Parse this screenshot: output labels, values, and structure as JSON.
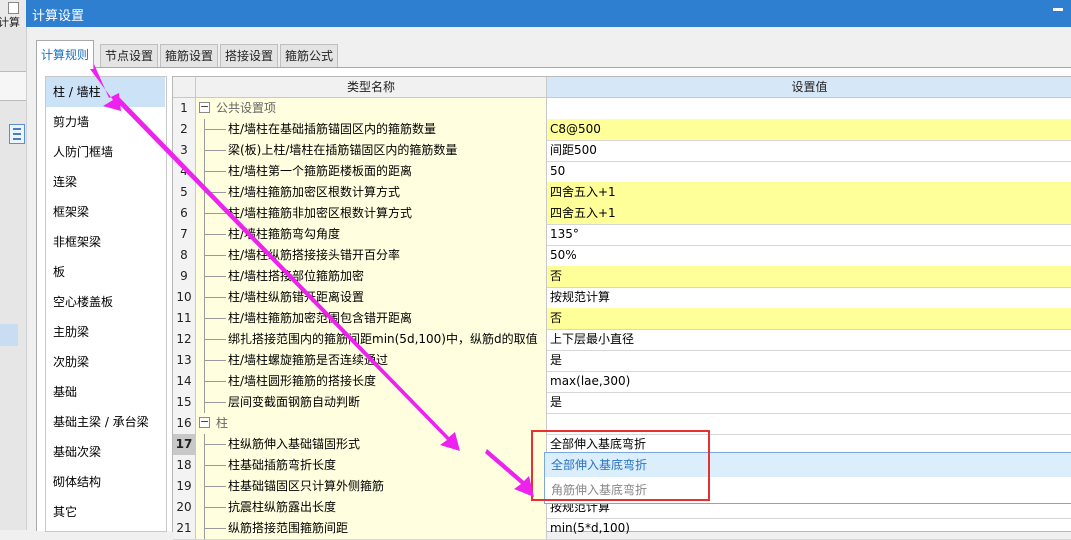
{
  "window": {
    "title": "计算设置",
    "app_title": "计算"
  },
  "tabs": [
    {
      "label": "计算规则",
      "active": true
    },
    {
      "label": "节点设置",
      "active": false
    },
    {
      "label": "箍筋设置",
      "active": false
    },
    {
      "label": "搭接设置",
      "active": false
    },
    {
      "label": "箍筋公式",
      "active": false
    }
  ],
  "categories": [
    "柱 / 墙柱",
    "剪力墙",
    "人防门框墙",
    "连梁",
    "框架梁",
    "非框架梁",
    "板",
    "空心楼盖板",
    "主肋梁",
    "次肋梁",
    "基础",
    "基础主梁 / 承台梁",
    "基础次梁",
    "砌体结构",
    "其它"
  ],
  "grid": {
    "col_name": "类型名称",
    "col_value": "设置值",
    "rows": [
      {
        "n": "1",
        "name": "公共设置项",
        "value": "",
        "group": true,
        "yellow": false
      },
      {
        "n": "2",
        "name": "柱/墙柱在基础插筋锚固区内的箍筋数量",
        "value": "C8@500",
        "group": false,
        "yellow": true
      },
      {
        "n": "3",
        "name": "梁(板)上柱/墙柱在插筋锚固区内的箍筋数量",
        "value": "间距500",
        "group": false,
        "yellow": false
      },
      {
        "n": "4",
        "name": "柱/墙柱第一个箍筋距楼板面的距离",
        "value": "50",
        "group": false,
        "yellow": false
      },
      {
        "n": "5",
        "name": "柱/墙柱箍筋加密区根数计算方式",
        "value": "四舍五入+1",
        "group": false,
        "yellow": true
      },
      {
        "n": "6",
        "name": "柱/墙柱箍筋非加密区根数计算方式",
        "value": "四舍五入+1",
        "group": false,
        "yellow": true
      },
      {
        "n": "7",
        "name": "柱/墙柱箍筋弯勾角度",
        "value": "135°",
        "group": false,
        "yellow": false
      },
      {
        "n": "8",
        "name": "柱/墙柱纵筋搭接接头错开百分率",
        "value": "50%",
        "group": false,
        "yellow": false
      },
      {
        "n": "9",
        "name": "柱/墙柱搭接部位箍筋加密",
        "value": "否",
        "group": false,
        "yellow": true
      },
      {
        "n": "10",
        "name": "柱/墙柱纵筋错开距离设置",
        "value": "按规范计算",
        "group": false,
        "yellow": false
      },
      {
        "n": "11",
        "name": "柱/墙柱箍筋加密范围包含错开距离",
        "value": "否",
        "group": false,
        "yellow": true
      },
      {
        "n": "12",
        "name": "绑扎搭接范围内的箍筋间距min(5d,100)中，纵筋d的取值",
        "value": "上下层最小直径",
        "group": false,
        "yellow": false
      },
      {
        "n": "13",
        "name": "柱/墙柱螺旋箍筋是否连续通过",
        "value": "是",
        "group": false,
        "yellow": false
      },
      {
        "n": "14",
        "name": "柱/墙柱圆形箍筋的搭接长度",
        "value": "max(lae,300)",
        "group": false,
        "yellow": false
      },
      {
        "n": "15",
        "name": "层间变截面钢筋自动判断",
        "value": "是",
        "group": false,
        "yellow": false
      },
      {
        "n": "16",
        "name": "柱",
        "value": "",
        "group": true,
        "yellow": false
      },
      {
        "n": "17",
        "name": "柱纵筋伸入基础锚固形式",
        "value": "全部伸入基底弯折",
        "group": false,
        "yellow": false,
        "current": true
      },
      {
        "n": "18",
        "name": "柱基础插筋弯折长度",
        "value": "",
        "group": false,
        "yellow": false
      },
      {
        "n": "19",
        "name": "柱基础锚固区只计算外侧箍筋",
        "value": "",
        "group": false,
        "yellow": false
      },
      {
        "n": "20",
        "name": "抗震柱纵筋露出长度",
        "value": "按规范计算",
        "group": false,
        "yellow": false
      },
      {
        "n": "21",
        "name": "纵筋搭接范围箍筋间距",
        "value": "min(5*d,100)",
        "group": false,
        "yellow": false
      }
    ]
  },
  "dropdown_options": [
    {
      "label": "全部伸入基底弯折",
      "highlighted": true
    },
    {
      "label": "角筋伸入基底弯折",
      "highlighted": false
    }
  ],
  "colors": {
    "title_bar": "#2f7fd0",
    "accent_tab": "#1a6fc4",
    "annotation_arrow": "#ee22ee",
    "annotation_box": "#e8302e",
    "row_yellow": "#ffff99",
    "name_cell": "#ffffe0"
  }
}
